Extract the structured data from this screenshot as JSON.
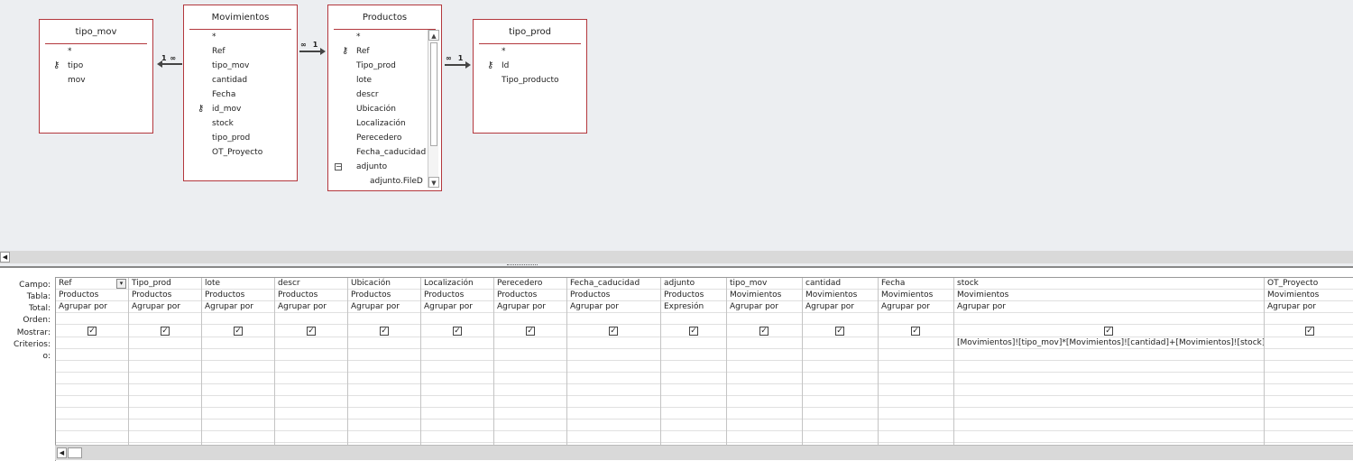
{
  "tables": {
    "tipo_mov": {
      "title": "tipo_mov",
      "fields": [
        "*",
        "tipo",
        "mov"
      ]
    },
    "movimientos": {
      "title": "Movimientos",
      "fields": [
        "*",
        "Ref",
        "tipo_mov",
        "cantidad",
        "Fecha",
        "id_mov",
        "stock",
        "tipo_prod",
        "OT_Proyecto"
      ]
    },
    "productos": {
      "title": "Productos",
      "fields": [
        "*",
        "Ref",
        "Tipo_prod",
        "lote",
        "descr",
        "Ubicación",
        "Localización",
        "Perecedero",
        "Fecha_caducidad",
        "adjunto",
        "adjunto.FileD"
      ]
    },
    "tipo_prod": {
      "title": "tipo_prod",
      "fields": [
        "*",
        "Id",
        "Tipo_producto"
      ]
    }
  },
  "relations": {
    "rel1": {
      "left": "1",
      "right": "∞"
    },
    "rel2": {
      "left": "∞",
      "right": "1"
    },
    "rel3": {
      "left": "∞",
      "right": "1"
    }
  },
  "row_labels": {
    "campo": "Campo:",
    "tabla": "Tabla:",
    "total": "Total:",
    "orden": "Orden:",
    "mostrar": "Mostrar:",
    "criterios": "Criterios:",
    "o": "o:"
  },
  "grid": {
    "columns": [
      {
        "campo": "Ref",
        "tabla": "Productos",
        "total": "Agrupar por",
        "mostrar": true,
        "criterios": ""
      },
      {
        "campo": "Tipo_prod",
        "tabla": "Productos",
        "total": "Agrupar por",
        "mostrar": true,
        "criterios": ""
      },
      {
        "campo": "lote",
        "tabla": "Productos",
        "total": "Agrupar por",
        "mostrar": true,
        "criterios": ""
      },
      {
        "campo": "descr",
        "tabla": "Productos",
        "total": "Agrupar por",
        "mostrar": true,
        "criterios": ""
      },
      {
        "campo": "Ubicación",
        "tabla": "Productos",
        "total": "Agrupar por",
        "mostrar": true,
        "criterios": ""
      },
      {
        "campo": "Localización",
        "tabla": "Productos",
        "total": "Agrupar por",
        "mostrar": true,
        "criterios": ""
      },
      {
        "campo": "Perecedero",
        "tabla": "Productos",
        "total": "Agrupar por",
        "mostrar": true,
        "criterios": ""
      },
      {
        "campo": "Fecha_caducidad",
        "tabla": "Productos",
        "total": "Agrupar por",
        "mostrar": true,
        "criterios": ""
      },
      {
        "campo": "adjunto",
        "tabla": "Productos",
        "total": "Expresión",
        "mostrar": true,
        "criterios": ""
      },
      {
        "campo": "tipo_mov",
        "tabla": "Movimientos",
        "total": "Agrupar por",
        "mostrar": true,
        "criterios": ""
      },
      {
        "campo": "cantidad",
        "tabla": "Movimientos",
        "total": "Agrupar por",
        "mostrar": true,
        "criterios": ""
      },
      {
        "campo": "Fecha",
        "tabla": "Movimientos",
        "total": "Agrupar por",
        "mostrar": true,
        "criterios": ""
      },
      {
        "campo": "stock",
        "tabla": "Movimientos",
        "total": "Agrupar por",
        "mostrar": true,
        "criterios": "[Movimientos]![tipo_mov]*[Movimientos]![cantidad]+[Movimientos]![stock]"
      },
      {
        "campo": "OT_Proyecto",
        "tabla": "Movimientos",
        "total": "Agrupar por",
        "mostrar": true,
        "criterios": ""
      }
    ]
  },
  "icons": {
    "key": "key-icon",
    "checkbox": "checkbox-checked-icon",
    "scroll_left": "scroll-left-icon",
    "scroll_up": "scroll-up-icon",
    "scroll_down": "scroll-down-icon",
    "dropdown": "dropdown-icon",
    "collapse": "collapse-icon"
  },
  "colors": {
    "table_border": "#b3373d",
    "design_bg": "#eceef1"
  }
}
